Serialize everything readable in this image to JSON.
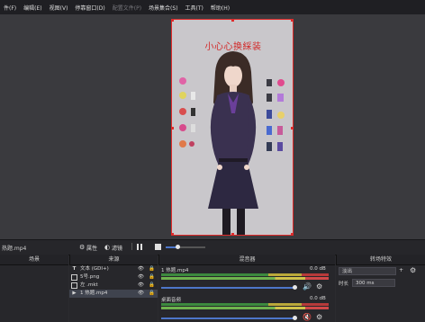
{
  "menu": [
    "件(F)",
    "编辑(E)",
    "视图(V)",
    "停靠窗口(D)",
    "配置文件(P)",
    "场景集合(S)",
    "工具(T)",
    "帮助(H)"
  ],
  "canvas": {
    "title": "小心心换綵装"
  },
  "preview_bar": {
    "source_name": "热题.mp4",
    "properties": "属性",
    "filters": "滤镜",
    "pause_icon": "pause-icon",
    "stop_icon": "stop-icon",
    "progress": 0.3
  },
  "docks": {
    "scenes": {
      "title": "场景"
    },
    "sources": {
      "title": "来源",
      "items": [
        {
          "icon": "text-icon",
          "name": "文本 (GDI+)"
        },
        {
          "icon": "image-icon",
          "name": "5号.png"
        },
        {
          "icon": "image-icon",
          "name": "左 .mkt"
        },
        {
          "icon": "media-icon",
          "name": "1 热题.mp4"
        }
      ]
    },
    "mixer": {
      "title": "混音器",
      "channels": [
        {
          "name": "1 热题.mp4",
          "db": "0.0 dB"
        },
        {
          "name": "桌面音频",
          "db": "0.0 dB"
        }
      ]
    },
    "transitions": {
      "title": "转场特效",
      "selected": "淡出",
      "duration_label": "时长",
      "duration_value": "300 ms"
    }
  },
  "colors": {
    "accent": "#4d76c9",
    "selection_border": "#e02a2a",
    "title_red": "#d22a2a"
  }
}
